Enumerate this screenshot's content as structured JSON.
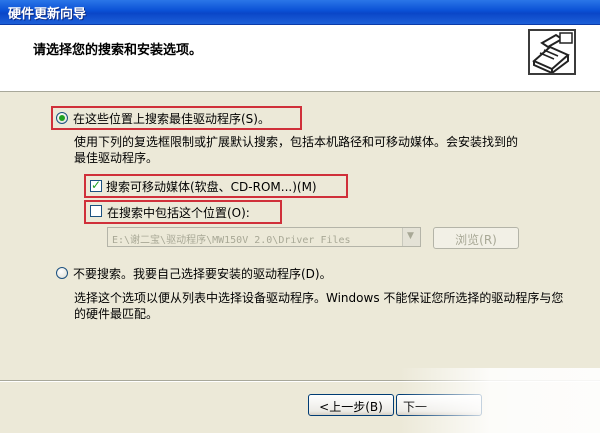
{
  "window": {
    "title": "硬件更新向导"
  },
  "header": {
    "heading": "请选择您的搜索和安装选项。",
    "icon": "hardware-wizard-icon"
  },
  "options": {
    "search_best": {
      "label": "在这些位置上搜索最佳驱动程序(S)。",
      "selected": true,
      "description": "使用下列的复选框限制或扩展默认搜索，包括本机路径和可移动媒体。会安装找到的最佳驱动程序。"
    },
    "search_removable": {
      "label": "搜索可移动媒体(软盘、CD-ROM...)(M)",
      "checked": true
    },
    "include_location": {
      "label": "在搜索中包括这个位置(O):",
      "checked": false
    },
    "path": {
      "value": "E:\\谢二宝\\驱动程序\\MW150V 2.0\\Driver Files"
    },
    "browse_label": "浏览(R)",
    "no_search": {
      "label": "不要搜索。我要自己选择要安装的驱动程序(D)。",
      "selected": false,
      "description": "选择这个选项以便从列表中选择设备驱动程序。Windows 不能保证您所选择的驱动程序与您的硬件最匹配。"
    }
  },
  "footer": {
    "back_label": "<上一步(B)",
    "next_label": "下一"
  },
  "colors": {
    "titlebar": "#0a50d5",
    "highlight": "#d0303a",
    "check": "#21a121"
  }
}
